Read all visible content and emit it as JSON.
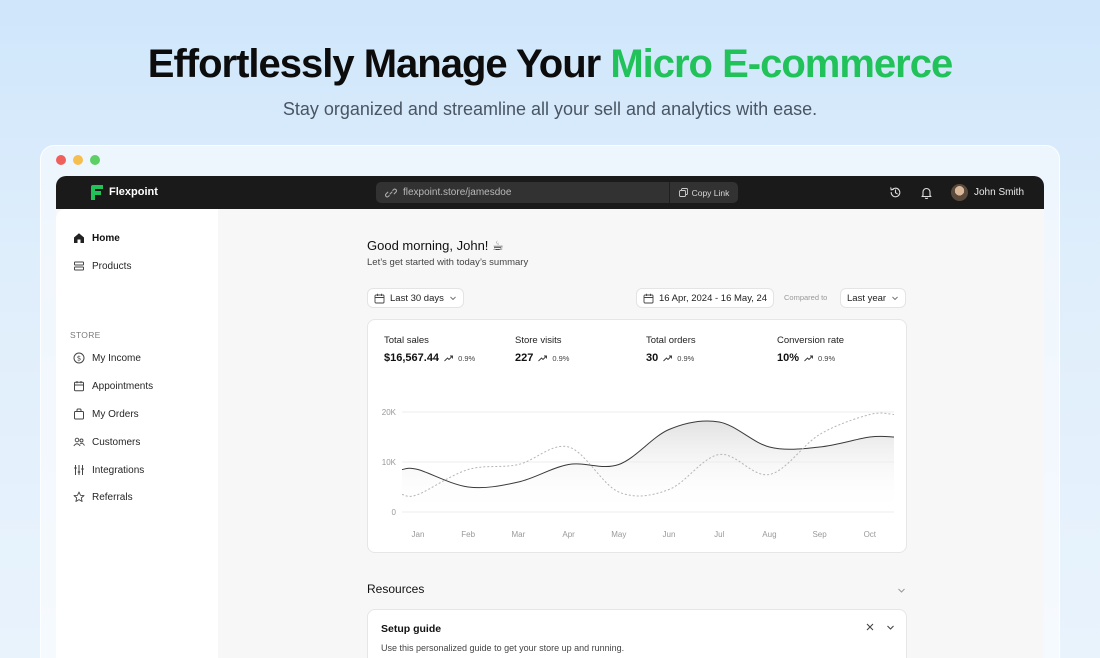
{
  "hero": {
    "title_prefix": "Effortlessly Manage Your ",
    "title_accent": "Micro E-commerce",
    "subtitle": "Stay organized and streamline all your sell and analytics with ease.",
    "accent_color": "#22c25a"
  },
  "topbar": {
    "brand": "Flexpoint",
    "url": "flexpoint.store/jamesdoe",
    "copy_label": "Copy Link",
    "user_name": "John Smith",
    "icons": [
      "history-icon",
      "bell-icon"
    ]
  },
  "sidebar": {
    "items_top": [
      {
        "label": "Home",
        "icon": "home-icon",
        "active": true
      },
      {
        "label": "Products",
        "icon": "products-icon",
        "active": false
      }
    ],
    "section_label": "STORE",
    "items_store": [
      {
        "label": "My Income",
        "icon": "dollar-icon"
      },
      {
        "label": "Appointments",
        "icon": "calendar-icon"
      },
      {
        "label": "My Orders",
        "icon": "bag-icon"
      },
      {
        "label": "Customers",
        "icon": "users-icon"
      },
      {
        "label": "Integrations",
        "icon": "sliders-icon"
      },
      {
        "label": "Referrals",
        "icon": "star-icon"
      }
    ]
  },
  "main": {
    "greeting": "Good morning, John! ☕",
    "greeting_sub": "Let’s get started with today’s summary",
    "range_filter": "Last 30 days",
    "date_range": "16 Apr, 2024 - 16 May, 24",
    "compared_label": "Compared to",
    "compare_filter": "Last year",
    "stats": [
      {
        "label": "Total sales",
        "value": "$16,567.44",
        "change": "0.9%"
      },
      {
        "label": "Store visits",
        "value": "227",
        "change": "0.9%"
      },
      {
        "label": "Total orders",
        "value": "30",
        "change": "0.9%"
      },
      {
        "label": "Conversion rate",
        "value": "10%",
        "change": "0.9%"
      }
    ],
    "resources_title": "Resources",
    "setup_title": "Setup guide",
    "setup_desc": "Use this personalized guide to get your store up and running."
  },
  "chart_data": {
    "type": "line",
    "categories": [
      "Jan",
      "Feb",
      "Mar",
      "Apr",
      "May",
      "Jun",
      "Jul",
      "Aug",
      "Sep",
      "Oct"
    ],
    "y_tick_labels": [
      "20K",
      "10K",
      "0"
    ],
    "ylim": [
      0,
      20000
    ],
    "series": [
      {
        "style": "solid",
        "values": [
          8500,
          5000,
          6000,
          9500,
          9500,
          16500,
          18000,
          13000,
          13000,
          15000
        ]
      },
      {
        "style": "dotted",
        "values": [
          3500,
          8500,
          9500,
          13000,
          4000,
          4500,
          11500,
          7500,
          15500,
          19500
        ]
      }
    ],
    "grid": true,
    "legend": "none"
  }
}
